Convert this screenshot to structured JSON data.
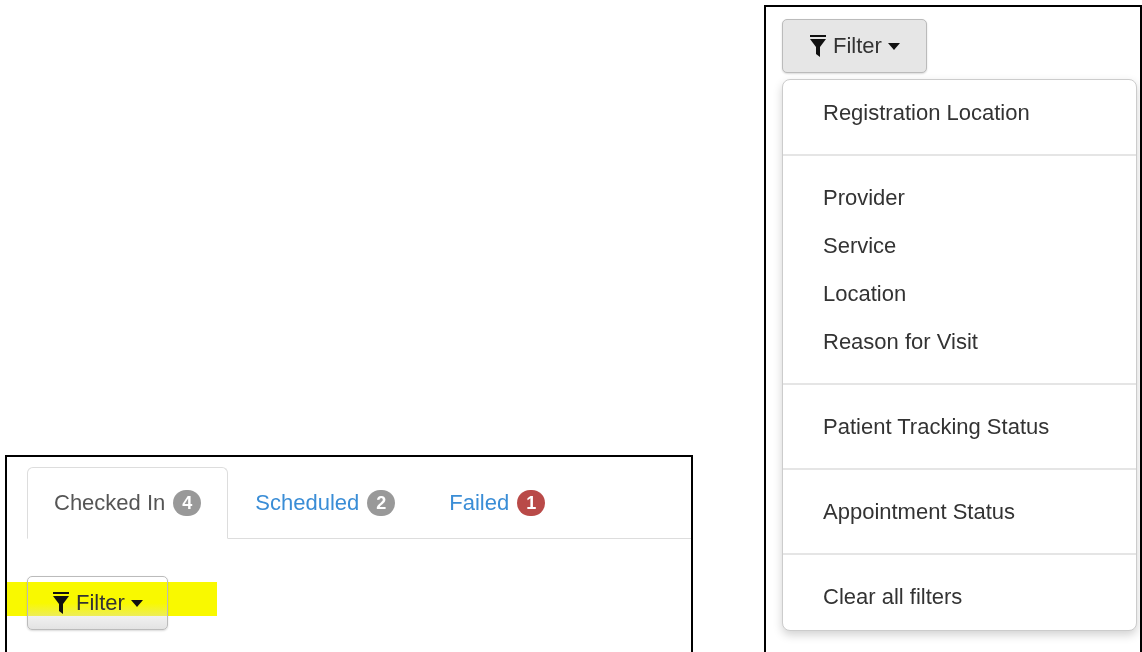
{
  "left_panel": {
    "tabs": [
      {
        "label": "Checked In",
        "count": "4",
        "color": "#999999",
        "selected": true
      },
      {
        "label": "Scheduled",
        "count": "2",
        "color": "#999999",
        "selected": false
      },
      {
        "label": "Failed",
        "count": "1",
        "color": "#b94a48",
        "selected": false
      }
    ],
    "filter_button": {
      "label": "Filter",
      "highlighted": true
    }
  },
  "right_panel": {
    "filter_button": {
      "label": "Filter"
    },
    "menu": {
      "groups": [
        {
          "items": [
            "Registration Location"
          ]
        },
        {
          "items": [
            "Provider",
            "Service",
            "Location",
            "Reason for Visit"
          ]
        },
        {
          "items": [
            "Patient Tracking Status"
          ]
        },
        {
          "items": [
            "Appointment Status"
          ]
        },
        {
          "items": [
            "Clear all filters"
          ]
        }
      ]
    }
  }
}
